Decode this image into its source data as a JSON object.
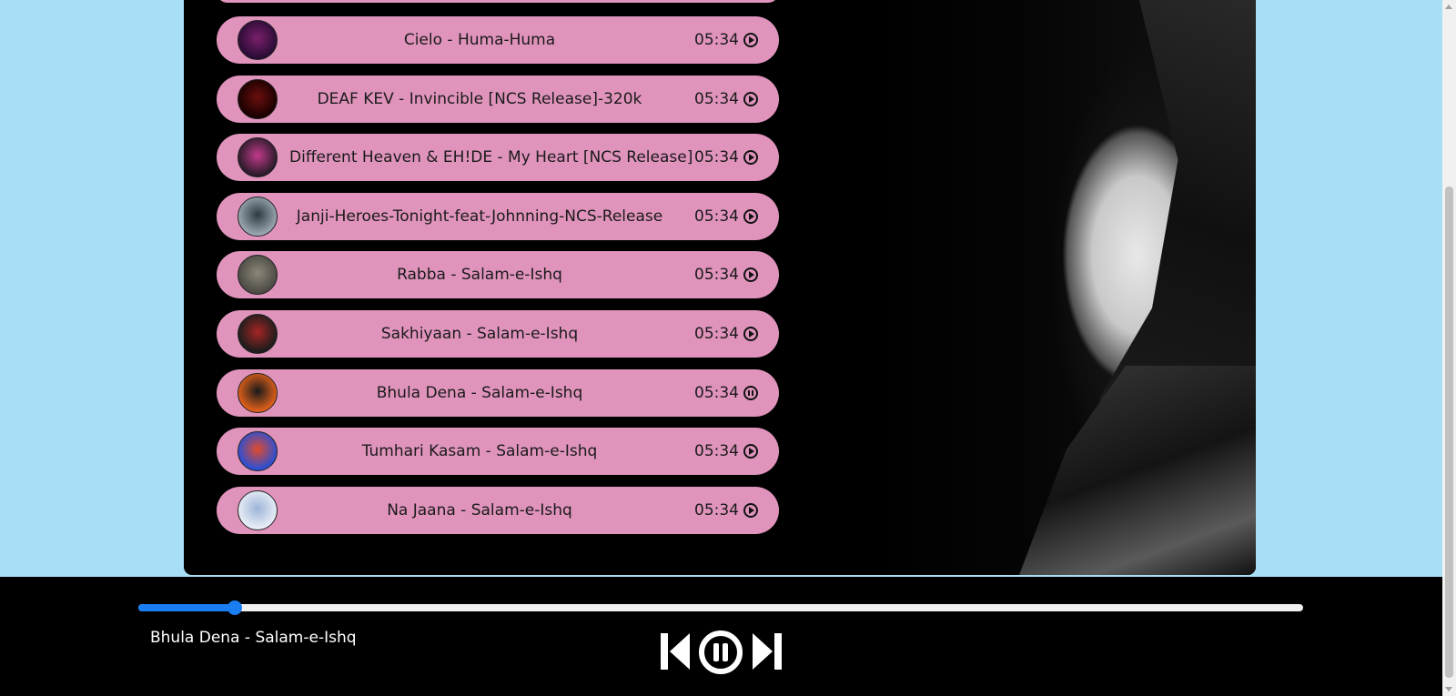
{
  "playlist": {
    "songs": [
      {
        "title": "Cielo - Huma-Huma",
        "duration": "05:34",
        "state": "play",
        "thumb_colors": [
          "#2a0c35",
          "#7a1f6b"
        ]
      },
      {
        "title": "DEAF KEV - Invincible [NCS Release]-320k",
        "duration": "05:34",
        "state": "play",
        "thumb_colors": [
          "#1a0000",
          "#6b0f0f"
        ]
      },
      {
        "title": "Different Heaven & EH!DE - My Heart [NCS Release]",
        "duration": "05:34",
        "state": "play",
        "thumb_colors": [
          "#2a1b2a",
          "#c23a8a"
        ]
      },
      {
        "title": "Janji-Heroes-Tonight-feat-Johnning-NCS-Release",
        "duration": "05:34",
        "state": "play",
        "thumb_colors": [
          "#9aa7b0",
          "#2f3a41"
        ]
      },
      {
        "title": "Rabba - Salam-e-Ishq",
        "duration": "05:34",
        "state": "play",
        "thumb_colors": [
          "#4c4a44",
          "#8b8778"
        ]
      },
      {
        "title": "Sakhiyaan - Salam-e-Ishq",
        "duration": "05:34",
        "state": "play",
        "thumb_colors": [
          "#1c1c1c",
          "#a52525"
        ]
      },
      {
        "title": "Bhula Dena - Salam-e-Ishq",
        "duration": "05:34",
        "state": "pause",
        "thumb_colors": [
          "#e0601a",
          "#1a1a1a"
        ]
      },
      {
        "title": "Tumhari Kasam - Salam-e-Ishq",
        "duration": "05:34",
        "state": "play",
        "thumb_colors": [
          "#2a4fd6",
          "#e24a2a"
        ]
      },
      {
        "title": "Na Jaana - Salam-e-Ishq",
        "duration": "05:34",
        "state": "play",
        "thumb_colors": [
          "#e8eef6",
          "#9db4d8"
        ]
      }
    ]
  },
  "player": {
    "now_playing": "Bhula Dena - Salam-e-Ishq",
    "progress": 0.083,
    "state": "playing",
    "accent_color": "#1a7ef2"
  },
  "colors": {
    "page_bg": "#a9def7",
    "song_card_bg": "#e094bc",
    "container_bg": "#000000"
  },
  "icons": {
    "prev": "skip-previous-icon",
    "pause": "pause-circle-icon",
    "next": "skip-next-icon",
    "song_play": "play-circle-icon",
    "song_pause": "pause-circle-icon"
  }
}
